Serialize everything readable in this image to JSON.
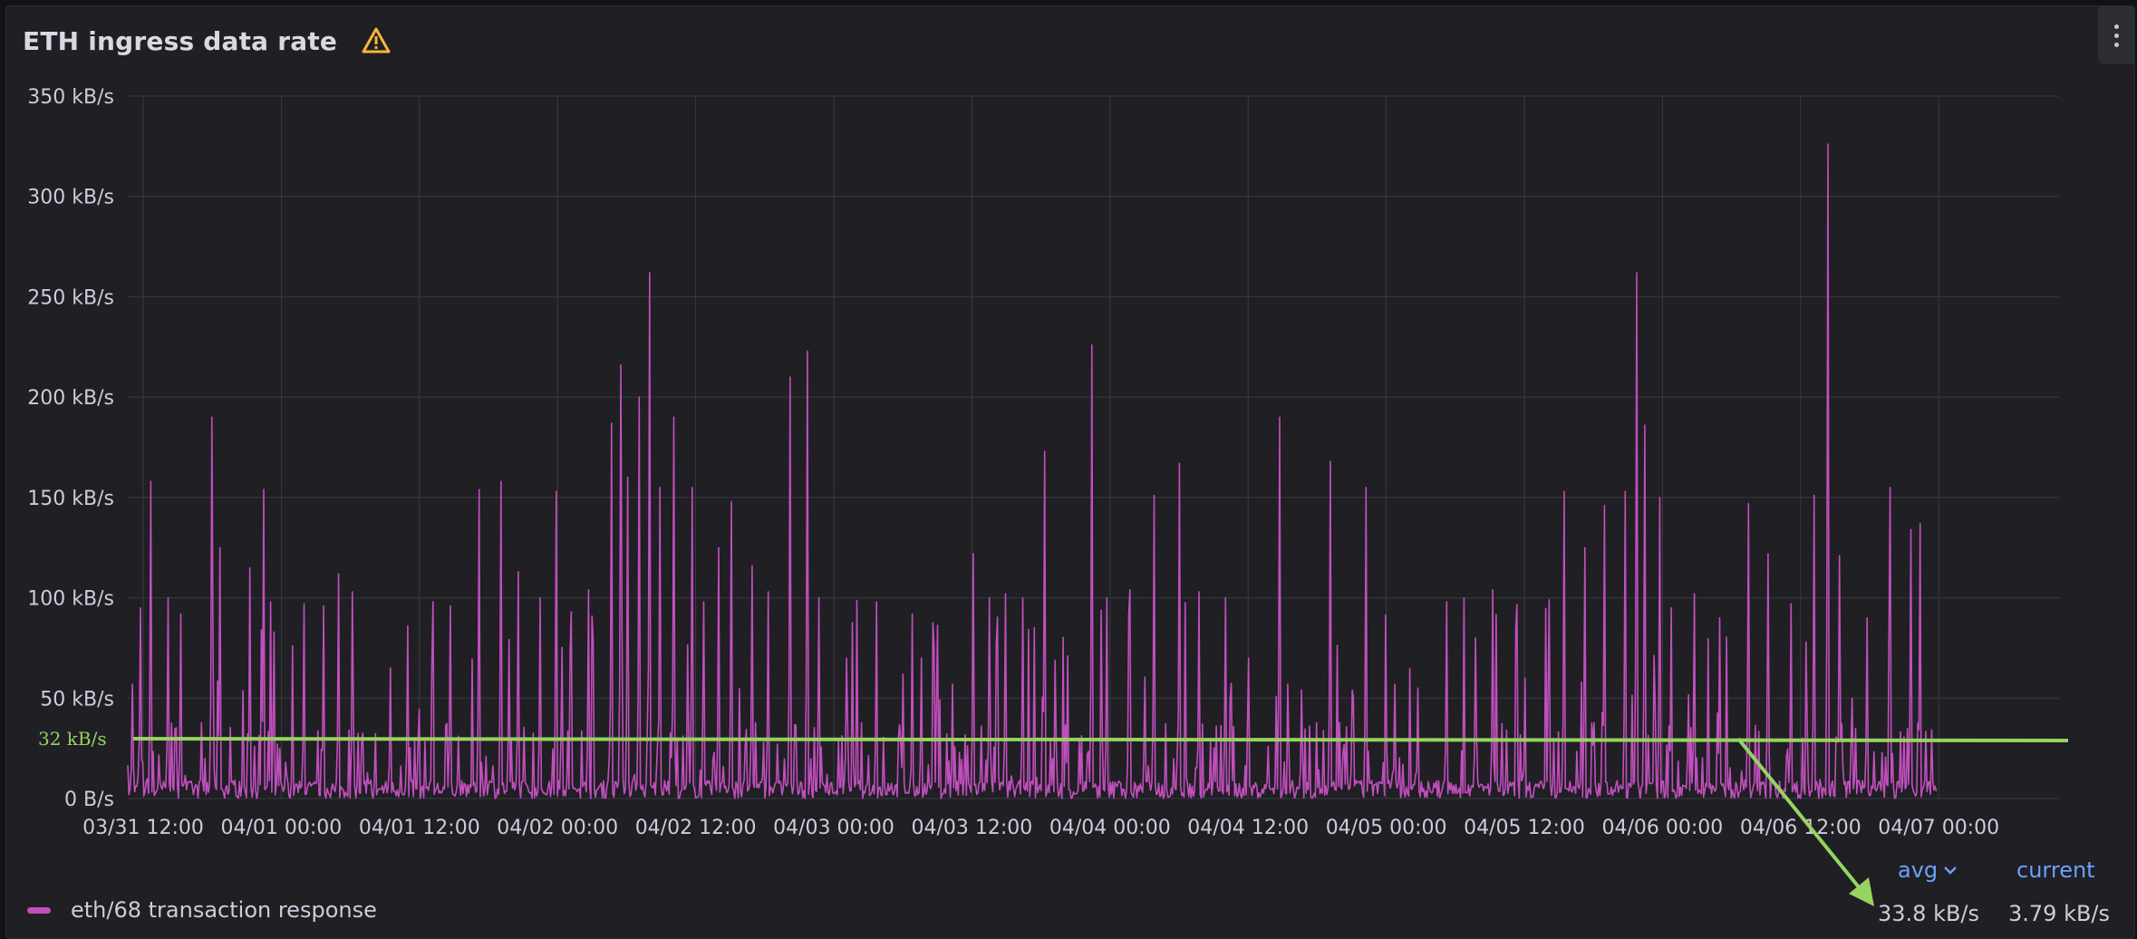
{
  "panel": {
    "title": "ETH ingress data rate",
    "warning_icon": "warning-triangle-icon",
    "menu_icon": "vertical-dots-icon"
  },
  "colors": {
    "series": "#c14fbd",
    "annotation": "#96d35f",
    "grid": "#3a3b42",
    "legend_header": "#6e9fff"
  },
  "chart_data": {
    "type": "line",
    "title": "ETH ingress data rate",
    "y_unit": "B/s",
    "ylim": [
      0,
      350000
    ],
    "y_ticks": [
      "0 B/s",
      "50 kB/s",
      "100 kB/s",
      "150 kB/s",
      "200 kB/s",
      "250 kB/s",
      "300 kB/s",
      "350 kB/s"
    ],
    "x_ticks": [
      "03/31 12:00",
      "04/01 00:00",
      "04/01 12:00",
      "04/02 00:00",
      "04/02 12:00",
      "04/03 00:00",
      "04/03 12:00",
      "04/04 00:00",
      "04/04 12:00",
      "04/05 00:00",
      "04/05 12:00",
      "04/06 00:00",
      "04/06 12:00",
      "04/07 00:00"
    ],
    "grid": true,
    "series": [
      {
        "name": "eth/68 transaction response",
        "peaks_hours_kBs": [
          [
            0.4,
            57
          ],
          [
            1.1,
            95
          ],
          [
            2.0,
            158
          ],
          [
            3.5,
            100
          ],
          [
            4.6,
            92
          ],
          [
            7.3,
            190
          ],
          [
            8.0,
            125
          ],
          [
            10.6,
            115
          ],
          [
            11.8,
            154
          ],
          [
            15.3,
            97
          ],
          [
            17.0,
            96
          ],
          [
            18.3,
            112
          ],
          [
            19.5,
            103
          ],
          [
            22.8,
            65
          ],
          [
            24.3,
            86
          ],
          [
            26.5,
            98
          ],
          [
            28.0,
            96
          ],
          [
            30.5,
            154
          ],
          [
            32.4,
            158
          ],
          [
            33.9,
            113
          ],
          [
            35.8,
            100
          ],
          [
            37.2,
            153
          ],
          [
            38.5,
            93
          ],
          [
            40.0,
            104
          ],
          [
            42.0,
            187
          ],
          [
            42.8,
            216
          ],
          [
            43.4,
            160
          ],
          [
            44.4,
            200
          ],
          [
            45.3,
            262
          ],
          [
            46.2,
            155
          ],
          [
            47.4,
            190
          ],
          [
            49.0,
            155
          ],
          [
            51.3,
            125
          ],
          [
            52.4,
            148
          ],
          [
            54.2,
            116
          ],
          [
            55.6,
            103
          ],
          [
            57.5,
            210
          ],
          [
            59.0,
            223
          ],
          [
            60.0,
            100
          ],
          [
            62.4,
            70
          ],
          [
            65.0,
            98
          ],
          [
            67.3,
            62
          ],
          [
            68.9,
            70
          ],
          [
            71.6,
            57
          ],
          [
            73.4,
            122
          ],
          [
            74.8,
            100
          ],
          [
            76.2,
            102
          ],
          [
            77.7,
            100
          ],
          [
            79.6,
            173
          ],
          [
            81.6,
            71
          ],
          [
            83.7,
            226
          ],
          [
            85.0,
            100
          ],
          [
            87.0,
            104
          ],
          [
            89.1,
            151
          ],
          [
            91.3,
            167
          ],
          [
            93.0,
            103
          ],
          [
            95.3,
            100
          ],
          [
            97.3,
            70
          ],
          [
            100.0,
            190
          ],
          [
            101.9,
            54
          ],
          [
            104.4,
            168
          ],
          [
            106.3,
            54
          ],
          [
            107.5,
            155
          ],
          [
            110.0,
            57
          ],
          [
            112.0,
            55
          ],
          [
            114.5,
            98
          ],
          [
            117.0,
            80
          ],
          [
            118.5,
            104
          ],
          [
            121.3,
            60
          ],
          [
            123.4,
            99
          ],
          [
            124.7,
            153
          ],
          [
            126.5,
            125
          ],
          [
            128.2,
            146
          ],
          [
            130.0,
            153
          ],
          [
            131.0,
            262
          ],
          [
            131.7,
            186
          ],
          [
            133.0,
            150
          ],
          [
            134.0,
            95
          ],
          [
            136.0,
            102
          ],
          [
            138.2,
            90
          ],
          [
            140.7,
            147
          ],
          [
            142.4,
            122
          ],
          [
            144.4,
            97
          ],
          [
            146.4,
            151
          ],
          [
            147.6,
            326
          ],
          [
            148.6,
            121
          ],
          [
            151.0,
            90
          ],
          [
            153.0,
            155
          ],
          [
            154.8,
            134
          ],
          [
            155.6,
            137
          ]
        ],
        "annotation_value": "32 kB/s"
      }
    ],
    "legend": {
      "placement": "bottom",
      "columns": [
        "avg",
        "current"
      ],
      "avg": "33.8 kB/s",
      "current": "3.79 kB/s"
    }
  },
  "legend": {
    "series_name": "eth/68 transaction response",
    "header_avg": "avg",
    "header_avg_icon": "chevron-down-icon",
    "header_current": "current",
    "value_avg": "33.8 kB/s",
    "value_current": "3.79 kB/s"
  },
  "annotation": {
    "label": "32 kB/s",
    "arrow_icon": "arrow-icon"
  }
}
